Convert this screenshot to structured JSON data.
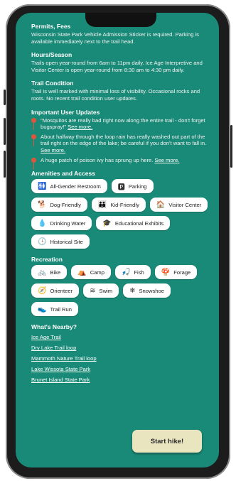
{
  "sections": {
    "permits": {
      "title": "Permits, Fees",
      "text": "Wisconsin State Park Vehicle Admission Sticker is required. Parking is available immediately next to the trail head."
    },
    "hours": {
      "title": "Hours/Season",
      "text": "Trails open year-round from 6am to 11pm daily. Ice Age Interpretive and Visitor Center is open year-round from 8:30 am to 4:30 pm daily."
    },
    "condition": {
      "title": "Trail Condition",
      "text": "Trail is well marked with minimal loss of visibility. Occasional rocks and roots. No recent trail condition user updates."
    },
    "updates": {
      "title": "Important User Updates",
      "items": [
        {
          "text": "\"Mosquitos are really bad right now along the entire trail - don't forget bugspray!\" ",
          "link": "See more."
        },
        {
          "text": "About halfway through the loop rain has really washed out part of the trail right on the edge of the lake; be careful if you don't want to fall in. ",
          "link": "See more."
        },
        {
          "text": "A huge patch of poison ivy has sprung up here. ",
          "link": "See more."
        }
      ]
    },
    "amenities": {
      "title": "Amenities and Access",
      "chips": [
        {
          "label": "All-Gender Restroom",
          "icon": "restroom-icon",
          "glyph": "🚻"
        },
        {
          "label": "Parking",
          "icon": "parking-icon",
          "glyph": "🅿"
        },
        {
          "label": "Dog-Friendly",
          "icon": "dog-icon",
          "glyph": "🐕"
        },
        {
          "label": "Kid-Friendly",
          "icon": "kid-icon",
          "glyph": "👪"
        },
        {
          "label": "Visitor Center",
          "icon": "visitor-center-icon",
          "glyph": "🏠"
        },
        {
          "label": "Drinking Water",
          "icon": "water-drop-icon",
          "glyph": "💧"
        },
        {
          "label": "Educational Exhibits",
          "icon": "graduation-cap-icon",
          "glyph": "🎓"
        },
        {
          "label": "Historical Site",
          "icon": "history-icon",
          "glyph": "🕓"
        }
      ]
    },
    "recreation": {
      "title": "Recreation",
      "chips": [
        {
          "label": "Bike",
          "icon": "bike-icon",
          "glyph": "🚲"
        },
        {
          "label": "Camp",
          "icon": "tent-icon",
          "glyph": "⛺"
        },
        {
          "label": "Fish",
          "icon": "fish-hook-icon",
          "glyph": "🎣"
        },
        {
          "label": "Forage",
          "icon": "mushroom-icon",
          "glyph": "🍄"
        },
        {
          "label": "Orienteer",
          "icon": "compass-icon",
          "glyph": "🧭"
        },
        {
          "label": "Swim",
          "icon": "waves-icon",
          "glyph": "≋"
        },
        {
          "label": "Snowshoe",
          "icon": "snowshoe-icon",
          "glyph": "❄"
        },
        {
          "label": "Trail Run",
          "icon": "shoe-icon",
          "glyph": "👟"
        }
      ]
    },
    "nearby": {
      "title": "What's Nearby?",
      "links": [
        "Ice Age Trail",
        "Dry Lake Trail loop",
        "Mammoth Nature Trail loop",
        "Lake Wissota State Park",
        "Brunet Island State Park"
      ]
    }
  },
  "start_button": "Start hike!",
  "colors": {
    "background": "#1a8a78",
    "chip": "#ffffff",
    "pin": "#e2553a",
    "start_button": "#e9e5bf"
  }
}
